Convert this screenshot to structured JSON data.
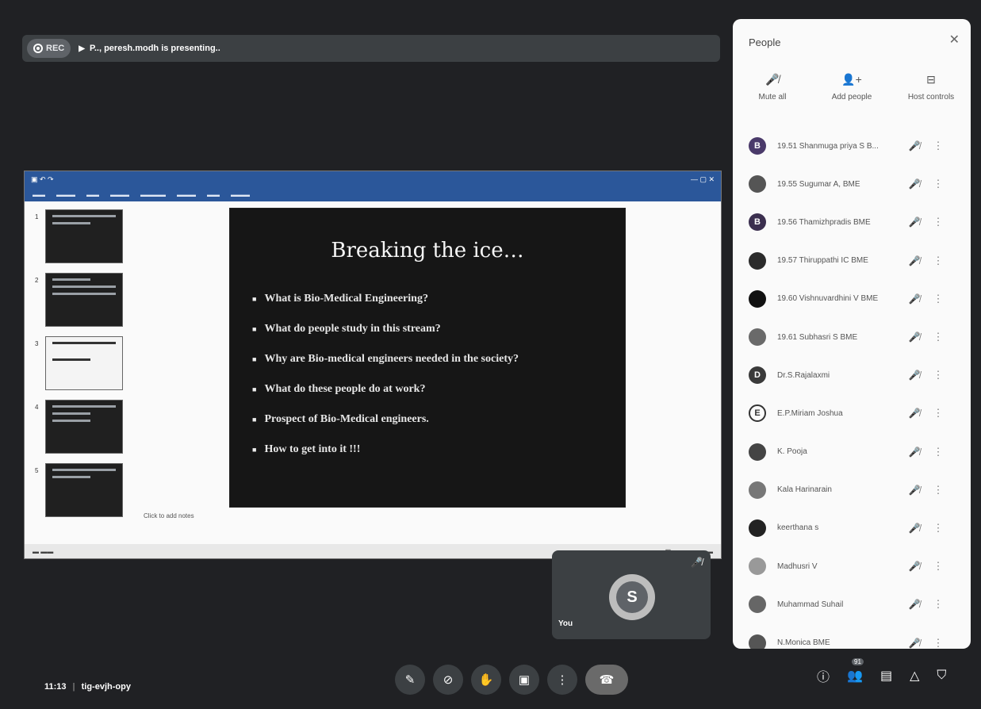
{
  "top_bar": {
    "rec_label": "REC",
    "presenting_text": "P.., peresh.modh is presenting.."
  },
  "presentation": {
    "slide_title": "Breaking the ice…",
    "bullets": [
      "What is Bio-Medical Engineering?",
      "What do people study in this stream?",
      "Why are Bio-medical engineers needed in the society?",
      "What do these people do at work?",
      "Prospect of Bio-Medical engineers.",
      "How to get into it !!!"
    ],
    "thumb_numbers": [
      "1",
      "2",
      "3",
      "4",
      "5"
    ],
    "notes_placeholder": "Click to add notes"
  },
  "self_tile": {
    "avatar_letter": "S",
    "label": "You"
  },
  "bottom_left": {
    "time": "11:13",
    "meeting_code": "tig-evjh-opy"
  },
  "bottom_right": {
    "participant_count": "91"
  },
  "panel": {
    "title": "People",
    "actions": [
      {
        "label": "Mute all",
        "icon": "mic-off-icon"
      },
      {
        "label": "Add people",
        "icon": "add-person-icon"
      },
      {
        "label": "Host controls",
        "icon": "host-controls-icon"
      }
    ],
    "people": [
      {
        "avatar": "B",
        "name": "19.51 Shanmuga priya S B...",
        "avatar_color": "#4a3a6a"
      },
      {
        "avatar": "",
        "name": "19.55 Sugumar A, BME",
        "avatar_color": "#555555"
      },
      {
        "avatar": "B",
        "name": "19.56 Thamizhpradis BME",
        "avatar_color": "#3b2f4f"
      },
      {
        "avatar": "",
        "name": "19.57 Thiruppathi IC BME",
        "avatar_color": "#2b2b2b"
      },
      {
        "avatar": "",
        "name": "19.60 Vishnuvardhini V BME",
        "avatar_color": "#111111"
      },
      {
        "avatar": "",
        "name": "19.61 Subhasri S BME",
        "avatar_color": "#6a6a6a"
      },
      {
        "avatar": "D",
        "name": "Dr.S.Rajalaxmi",
        "avatar_color": "#3a3a3a"
      },
      {
        "avatar": "E",
        "name": "E.P.Miriam Joshua",
        "avatar_color": "#fafafa"
      },
      {
        "avatar": "",
        "name": "K. Pooja",
        "avatar_color": "#444444"
      },
      {
        "avatar": "",
        "name": "Kala Harinarain",
        "avatar_color": "#777777"
      },
      {
        "avatar": "",
        "name": "keerthana s",
        "avatar_color": "#222222"
      },
      {
        "avatar": "",
        "name": "Madhusri V",
        "avatar_color": "#999999"
      },
      {
        "avatar": "",
        "name": "Muhammad Suhail",
        "avatar_color": "#666666"
      },
      {
        "avatar": "",
        "name": "N.Monica BME",
        "avatar_color": "#555555"
      }
    ]
  }
}
